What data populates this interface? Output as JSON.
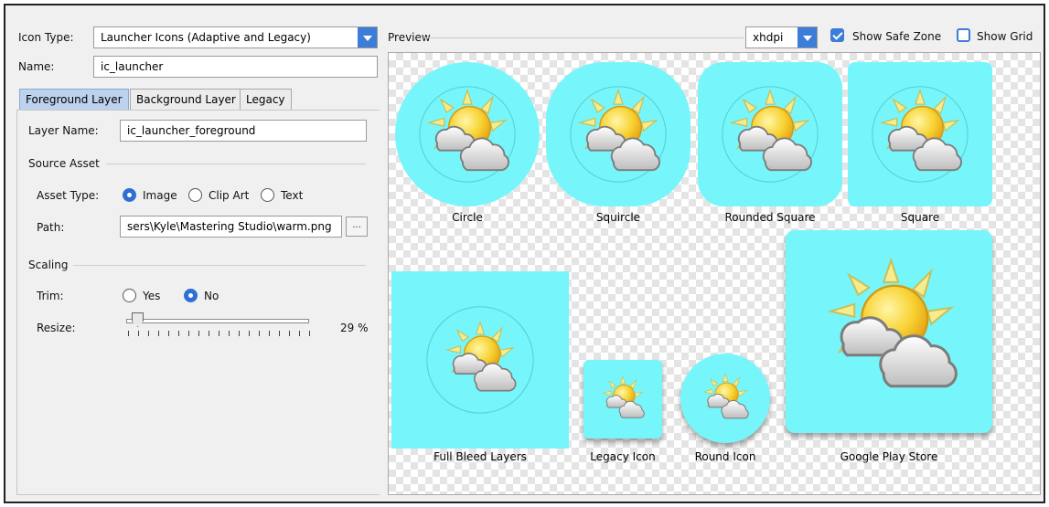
{
  "form": {
    "icon_type_label": "Icon Type:",
    "icon_type_value": "Launcher Icons (Adaptive and Legacy)",
    "name_label": "Name:",
    "name_value": "ic_launcher"
  },
  "tabs": [
    {
      "label": "Foreground Layer",
      "active": true
    },
    {
      "label": "Background Layer",
      "active": false
    },
    {
      "label": "Legacy",
      "active": false
    }
  ],
  "layer": {
    "layer_name_label": "Layer Name:",
    "layer_name_value": "ic_launcher_foreground",
    "source_asset_heading": "Source Asset",
    "asset_type_label": "Asset Type:",
    "asset_type_options": [
      "Image",
      "Clip Art",
      "Text"
    ],
    "asset_type_selected": "Image",
    "path_label": "Path:",
    "path_value": "sers\\Kyle\\Mastering Studio\\warm.png",
    "browse_label": "...",
    "scaling_heading": "Scaling",
    "trim_label": "Trim:",
    "trim_options": [
      "Yes",
      "No"
    ],
    "trim_selected": "No",
    "resize_label": "Resize:",
    "resize_value": "29 %",
    "resize_fraction": 0.29
  },
  "preview": {
    "heading": "Preview",
    "density_value": "xhdpi",
    "show_safe_zone_label": "Show Safe Zone",
    "show_safe_zone_checked": true,
    "show_grid_label": "Show Grid",
    "show_grid_checked": false,
    "icon_color": "#76f6fb",
    "captions": {
      "circle": "Circle",
      "squircle": "Squircle",
      "rounded_square": "Rounded Square",
      "square": "Square",
      "full_bleed": "Full Bleed Layers",
      "legacy": "Legacy Icon",
      "round": "Round Icon",
      "play_store": "Google Play Store"
    }
  }
}
